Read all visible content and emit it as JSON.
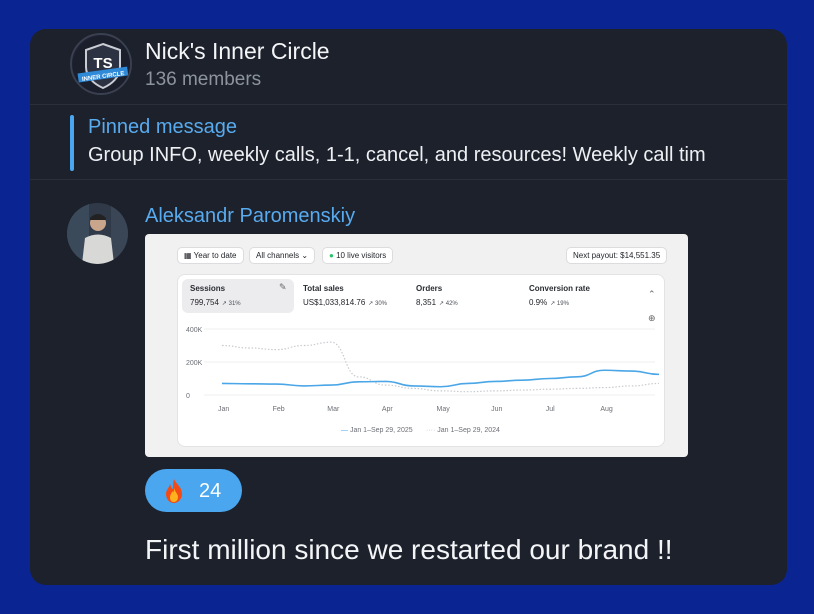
{
  "group": {
    "title": "Nick's Inner Circle",
    "members": "136 members",
    "avatar_text": "TS",
    "avatar_banner": "INNER CIRCLE"
  },
  "pinned": {
    "title": "Pinned message",
    "text": "Group INFO, weekly calls, 1-1, cancel, and resources!   Weekly call tim"
  },
  "message": {
    "sender": "Aleksandr Paromenskiy",
    "text": "First million since we restarted our brand !!",
    "reaction": {
      "emoji": "fire-icon",
      "count": "24"
    }
  },
  "screenshot": {
    "filters": [
      "Year to date",
      "All channels",
      "10 live visitors"
    ],
    "payout": "Next payout: $14,551.35",
    "metrics": [
      {
        "label": "Sessions",
        "value": "799,754",
        "delta": "↗ 31%"
      },
      {
        "label": "Total sales",
        "value": "US$1,033,814.76",
        "delta": "↗ 30%"
      },
      {
        "label": "Orders",
        "value": "8,351",
        "delta": "↗ 42%"
      },
      {
        "label": "Conversion rate",
        "value": "0.9%",
        "delta": "↗ 19%"
      }
    ],
    "legend": [
      "Jan 1–Sep 29, 2025",
      "Jan 1–Sep 29, 2024"
    ]
  },
  "chart_data": {
    "type": "line",
    "x": [
      "Jan",
      "Feb",
      "Mar",
      "Apr",
      "May",
      "Jun",
      "Jul",
      "Aug"
    ],
    "yticks": [
      "400K",
      "200K",
      "0"
    ],
    "ylim": [
      0,
      400000
    ],
    "series": [
      {
        "name": "Jan 1–Sep 29, 2025",
        "style": "solid",
        "color": "#4aa6e6",
        "points": [
          [
            0,
            70000
          ],
          [
            0.5,
            68000
          ],
          [
            1,
            66000
          ],
          [
            1.5,
            55000
          ],
          [
            2,
            60000
          ],
          [
            2.5,
            80000
          ],
          [
            3,
            82000
          ],
          [
            3.5,
            55000
          ],
          [
            4,
            50000
          ],
          [
            4.5,
            70000
          ],
          [
            5,
            82000
          ],
          [
            5.5,
            90000
          ],
          [
            6,
            100000
          ],
          [
            6.5,
            110000
          ],
          [
            7,
            150000
          ],
          [
            7.5,
            145000
          ],
          [
            8,
            125000
          ]
        ]
      },
      {
        "name": "Jan 1–Sep 29, 2024",
        "style": "dotted",
        "color": "#c8cace",
        "points": [
          [
            0,
            300000
          ],
          [
            0.5,
            285000
          ],
          [
            1,
            275000
          ],
          [
            1.5,
            300000
          ],
          [
            2,
            320000
          ],
          [
            2.5,
            110000
          ],
          [
            3,
            60000
          ],
          [
            3.5,
            40000
          ],
          [
            4,
            25000
          ],
          [
            4.5,
            20000
          ],
          [
            5,
            25000
          ],
          [
            5.5,
            30000
          ],
          [
            6,
            35000
          ],
          [
            6.5,
            40000
          ],
          [
            7,
            45000
          ],
          [
            7.5,
            55000
          ],
          [
            8,
            70000
          ]
        ]
      }
    ]
  }
}
